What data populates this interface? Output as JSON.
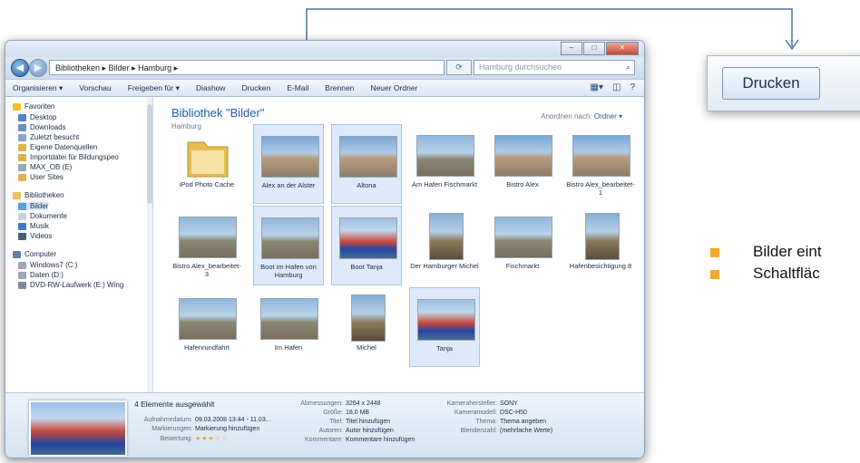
{
  "window": {
    "title_controls": [
      "–",
      "□",
      "✕"
    ],
    "breadcrumb": "Bibliotheken ▸ Bilder ▸ Hamburg ▸",
    "search_placeholder": "Hamburg durchsuchen"
  },
  "toolbar": {
    "items": [
      "Organisieren ▾",
      "Vorschau",
      "Freigeben für ▾",
      "Diashow",
      "Drucken",
      "E-Mail",
      "Brennen",
      "Neuer Ordner"
    ]
  },
  "nav": {
    "favorites_header": "Favoriten",
    "favorites": [
      "Desktop",
      "Downloads",
      "Zuletzt besucht",
      "Eigene Datenquellen",
      "Importdatei für Bildungspeo",
      "MAX_OB (E)",
      "User Sites"
    ],
    "libraries_header": "Bibliotheken",
    "libraries": [
      "Bilder",
      "Dokumente",
      "Musik",
      "Videos"
    ],
    "computer_header": "Computer",
    "computer": [
      "Windows7 (C:)",
      "Daten (D:)",
      "DVD-RW-Laufwerk (E:) Wing"
    ]
  },
  "library": {
    "title": "Bibliothek \"Bilder\"",
    "subtitle": "Hamburg",
    "arrange_label": "Anordnen nach:",
    "arrange_value": "Ordner ▾"
  },
  "tiles": [
    {
      "caption": "iPod Photo Cache",
      "kind": "folder",
      "selected": false
    },
    {
      "caption": "Alex an der Alster",
      "kind": "town",
      "selected": true
    },
    {
      "caption": "Altona",
      "kind": "town",
      "selected": true
    },
    {
      "caption": "Am Hafen Fischmarkt",
      "kind": "photo",
      "selected": false
    },
    {
      "caption": "Bistro Alex",
      "kind": "town",
      "selected": false
    },
    {
      "caption": "Bistro Alex_bearbeitet-1",
      "kind": "town",
      "selected": false
    },
    {
      "caption": "Bistro Alex_bearbeitet-3",
      "kind": "photo",
      "selected": false
    },
    {
      "caption": "Boot im Hafen von Hamburg",
      "kind": "photo",
      "selected": true
    },
    {
      "caption": "Boot Tanja",
      "kind": "boat",
      "selected": true
    },
    {
      "caption": "Der Hamburger Michel",
      "kind": "tall",
      "selected": false
    },
    {
      "caption": "Fischmarkt",
      "kind": "photo",
      "selected": false
    },
    {
      "caption": "Hafenbesichtigung 8",
      "kind": "tall",
      "selected": false
    },
    {
      "caption": "Hafenrundfahrt",
      "kind": "photo",
      "selected": false
    },
    {
      "caption": "Im Hafen",
      "kind": "photo",
      "selected": false
    },
    {
      "caption": "Michel",
      "kind": "tall",
      "selected": false
    },
    {
      "caption": "Tanja",
      "kind": "boat",
      "selected": true
    }
  ],
  "details": {
    "count": "4 Elemente ausgewählt",
    "col1": [
      {
        "k": "Aufnahmedatum:",
        "v": "09.03.2008 13:44 - 11.03..."
      },
      {
        "k": "Markierungen:",
        "v": "Markierung hinzufügen"
      },
      {
        "k": "Bewertung:",
        "v": "★★★☆☆"
      }
    ],
    "col2": [
      {
        "k": "Abmessungen:",
        "v": "3264 x 2448"
      },
      {
        "k": "Größe:",
        "v": "18,0 MB"
      },
      {
        "k": "Titel:",
        "v": "Titel hinzufügen"
      },
      {
        "k": "Autoren:",
        "v": "Autor hinzufügen"
      },
      {
        "k": "Kommentare:",
        "v": "Kommentare hinzufügen"
      }
    ],
    "col3": [
      {
        "k": "Kamerahersteller:",
        "v": "SONY"
      },
      {
        "k": "Kameramodell:",
        "v": "DSC-H50"
      },
      {
        "k": "Thema:",
        "v": "Thema angeben"
      },
      {
        "k": "Blendenzahl:",
        "v": "(mehrfache Werte)"
      }
    ]
  },
  "zoom_button": {
    "label": "Drucken"
  },
  "bullets": [
    "Bilder eint",
    "Schaltfläc"
  ],
  "colors": {
    "accent": "#f7a827",
    "library_title": "#1e5bb0",
    "selection": "#ddeafb"
  }
}
